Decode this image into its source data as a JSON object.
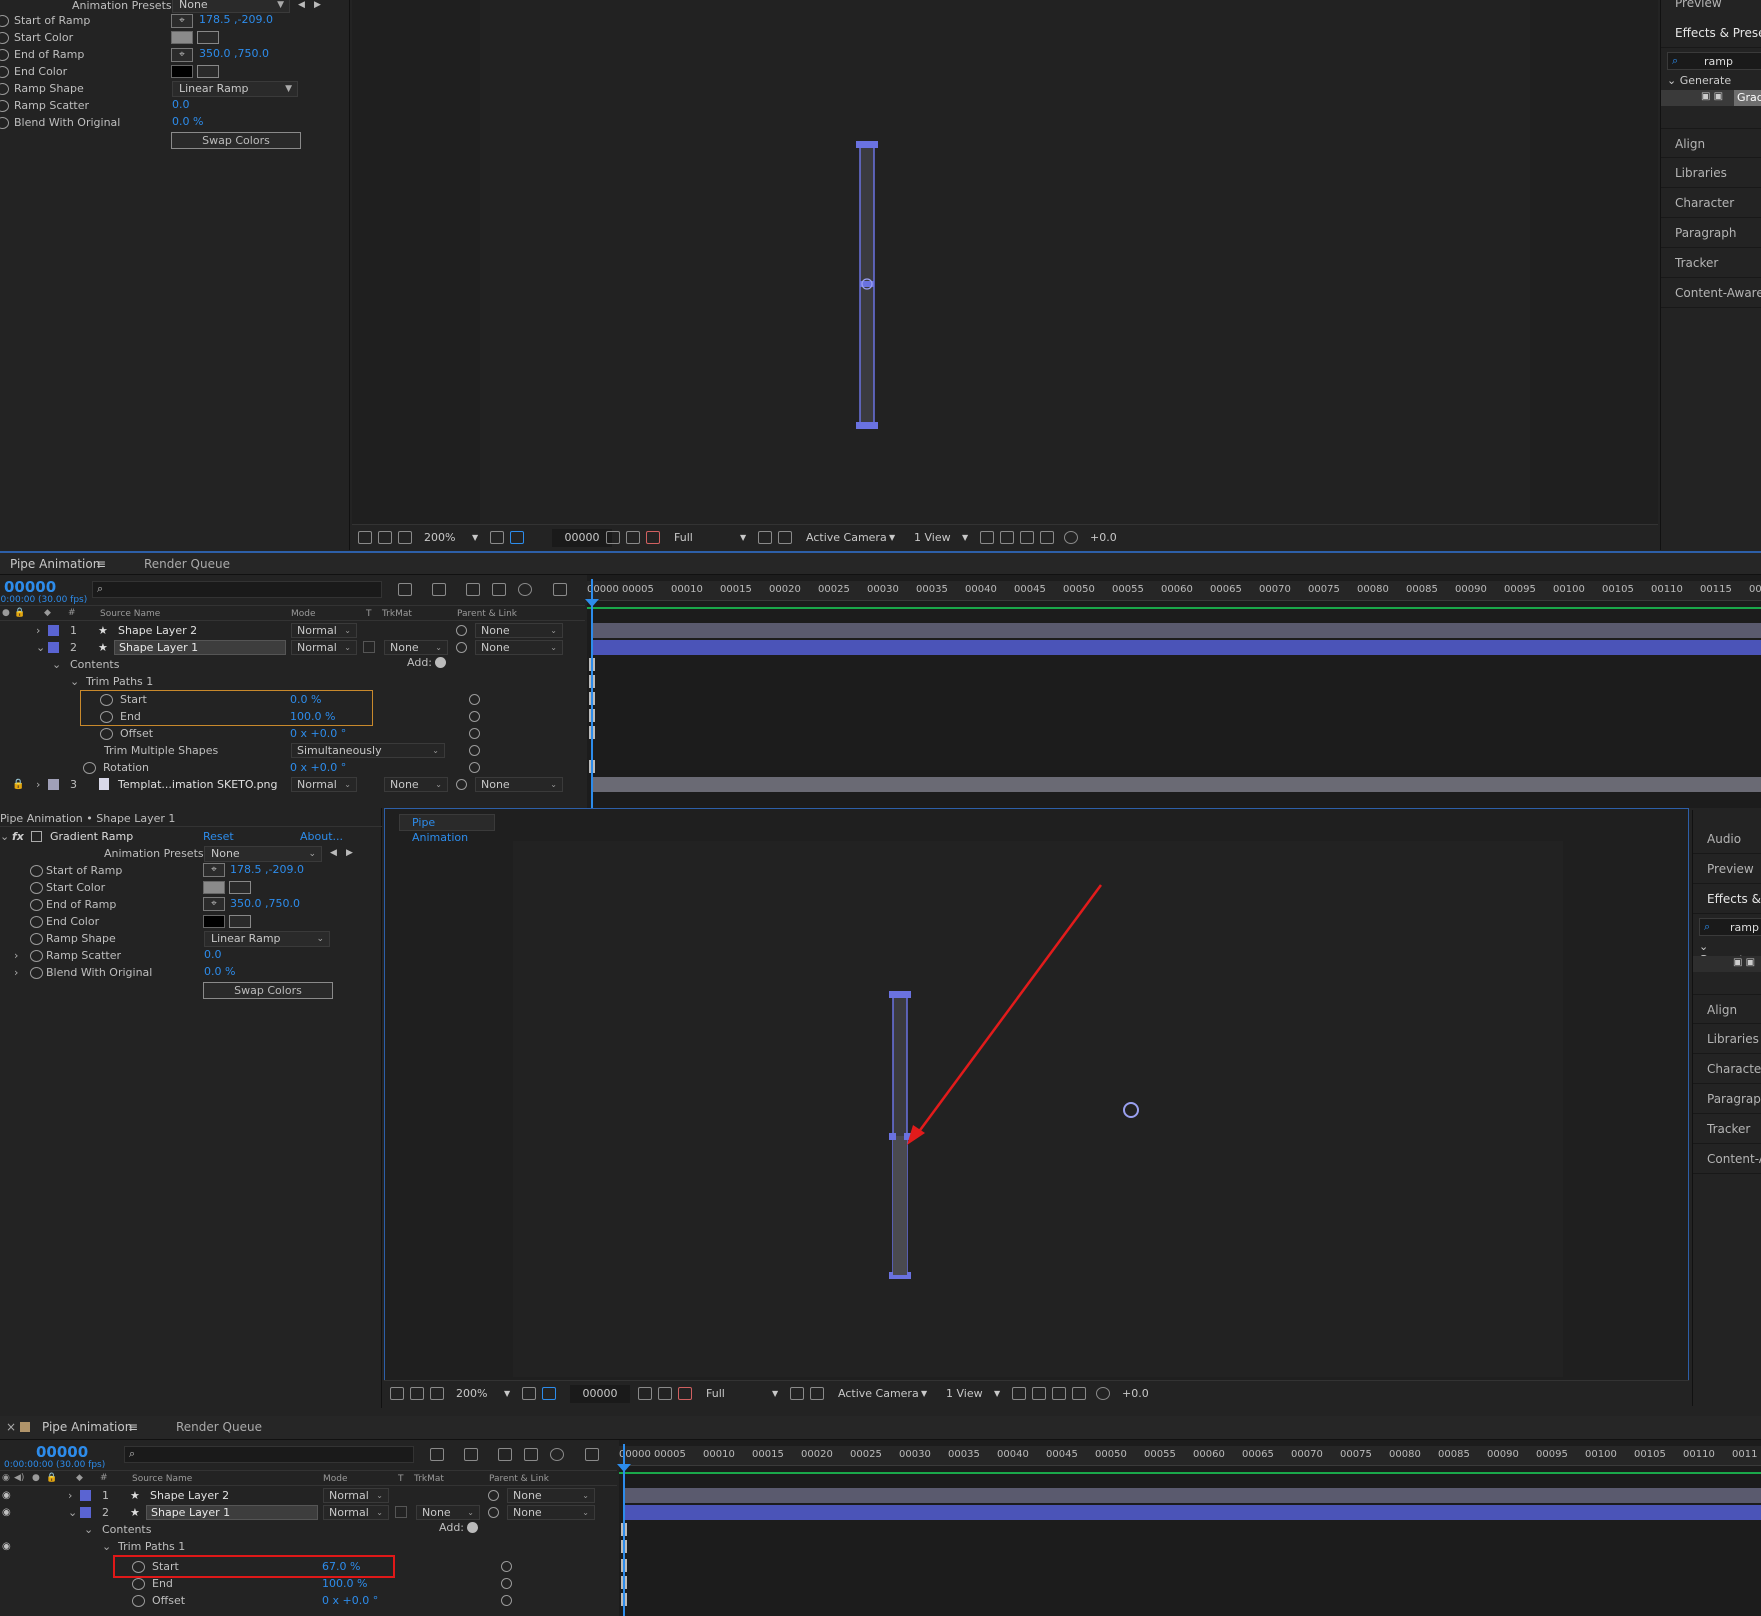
{
  "colors": {
    "accent_blue": "#2d8ceb",
    "layer_blue": "#5a64d2",
    "bar_blue": "#4b54b8",
    "bar_grey": "#5a5a6e",
    "highlight_orange": "#c8892c",
    "highlight_red": "#e01818",
    "arrow_red": "#e21b1b",
    "green_track": "#1aa84a"
  },
  "top": {
    "effect_controls": {
      "presets_label": "Animation Presets:",
      "presets_value": "None",
      "rows": [
        {
          "label": "Start of Ramp",
          "value": "178.5 ,-209.0"
        },
        {
          "label": "Start Color",
          "value": ""
        },
        {
          "label": "End of Ramp",
          "value": "350.0 ,750.0"
        },
        {
          "label": "End Color",
          "value": ""
        },
        {
          "label": "Ramp Shape",
          "value": "Linear Ramp"
        },
        {
          "label": "Ramp Scatter",
          "value": "0.0"
        },
        {
          "label": "Blend With Original",
          "value": "0.0 %"
        }
      ],
      "swap_colors": "Swap Colors"
    },
    "viewer_toolbar": {
      "zoom": "200%",
      "time": "00000",
      "resolution": "Full",
      "camera": "Active Camera",
      "views": "1 View",
      "exposure": "+0.0"
    },
    "right_panel": {
      "items": [
        "Preview",
        "Effects & Presets",
        "ramp",
        "Generate",
        "Gradi",
        "Align",
        "Libraries",
        "Character",
        "Paragraph",
        "Tracker",
        "Content-Aware F"
      ]
    },
    "timeline": {
      "tab_name": "Pipe Animation",
      "render_queue": "Render Queue",
      "timecode": "00000",
      "fps": "0:00:00:00 (30.00 fps)",
      "columns": {
        "source": "Source Name",
        "mode": "Mode",
        "t": "T",
        "trkmat": "TrkMat",
        "parent": "Parent & Link"
      },
      "layers": [
        {
          "num": "1",
          "name": "Shape Layer 2",
          "mode": "Normal",
          "trkmat": "",
          "parent": "None"
        },
        {
          "num": "2",
          "name": "Shape Layer 1",
          "mode": "Normal",
          "trkmat": "None",
          "parent": "None"
        }
      ],
      "contents": "Contents",
      "add": "Add:",
      "trim_paths": "Trim Paths 1",
      "props": [
        {
          "label": "Start",
          "value": "0.0 %"
        },
        {
          "label": "End",
          "value": "100.0 %"
        },
        {
          "label": "Offset",
          "value": "0 x +0.0 °"
        }
      ],
      "trim_multiple": "Trim Multiple Shapes",
      "trim_multiple_value": "Simultaneously",
      "rotation": "Rotation",
      "rotation_value": "0 x +0.0 °",
      "layer3": {
        "num": "3",
        "name": "Templat...imation SKETO.png",
        "mode": "Normal",
        "trkmat": "None",
        "parent": "None"
      },
      "ruler": [
        "00000",
        "00005",
        "00010",
        "00015",
        "00020",
        "00025",
        "00030",
        "00035",
        "00040",
        "00045",
        "00050",
        "00055",
        "00060",
        "00065",
        "00070",
        "00075",
        "00080",
        "00085",
        "00090",
        "00095",
        "00100",
        "00105",
        "00110",
        "00115",
        "00"
      ]
    }
  },
  "bottom": {
    "effect_controls": {
      "header": "Pipe Animation • Shape Layer 1",
      "fx_name": "Gradient Ramp",
      "reset": "Reset",
      "about": "About...",
      "presets_label": "Animation Presets:",
      "presets_value": "None",
      "rows": [
        {
          "label": "Start of Ramp",
          "value": "178.5 ,-209.0"
        },
        {
          "label": "Start Color",
          "value": ""
        },
        {
          "label": "End of Ramp",
          "value": "350.0 ,750.0"
        },
        {
          "label": "End Color",
          "value": ""
        },
        {
          "label": "Ramp Shape",
          "value": "Linear Ramp"
        },
        {
          "label": "Ramp Scatter",
          "value": "0.0"
        },
        {
          "label": "Blend With Original",
          "value": "0.0 %"
        }
      ],
      "swap_colors": "Swap Colors"
    },
    "comp_tab": "Pipe Animation",
    "viewer_toolbar": {
      "zoom": "200%",
      "time": "00000",
      "resolution": "Full",
      "camera": "Active Camera",
      "views": "1 View",
      "exposure": "+0.0"
    },
    "right_panel": {
      "items": [
        "Audio",
        "Preview",
        "Effects & P",
        "ramp",
        "Generate",
        "Align",
        "Libraries",
        "Character",
        "Paragraph",
        "Tracker",
        "Content-Av"
      ]
    },
    "timeline": {
      "tab_name": "Pipe Animation",
      "render_queue": "Render Queue",
      "timecode": "00000",
      "fps": "0:00:00:00 (30.00 fps)",
      "columns": {
        "source": "Source Name",
        "mode": "Mode",
        "t": "T",
        "trkmat": "TrkMat",
        "parent": "Parent & Link"
      },
      "layers": [
        {
          "num": "1",
          "name": "Shape Layer 2",
          "mode": "Normal",
          "trkmat": "",
          "parent": "None"
        },
        {
          "num": "2",
          "name": "Shape Layer 1",
          "mode": "Normal",
          "trkmat": "None",
          "parent": "None"
        }
      ],
      "contents": "Contents",
      "add": "Add:",
      "trim_paths": "Trim Paths 1",
      "props": [
        {
          "label": "Start",
          "value": "67.0 %"
        },
        {
          "label": "End",
          "value": "100.0 %"
        },
        {
          "label": "Offset",
          "value": "0 x +0.0 °"
        }
      ],
      "ruler": [
        "00000",
        "00005",
        "00010",
        "00015",
        "00020",
        "00025",
        "00030",
        "00035",
        "00040",
        "00045",
        "00050",
        "00055",
        "00060",
        "00065",
        "00070",
        "00075",
        "00080",
        "00085",
        "00090",
        "00095",
        "00100",
        "00105",
        "00110",
        "0011"
      ]
    }
  }
}
